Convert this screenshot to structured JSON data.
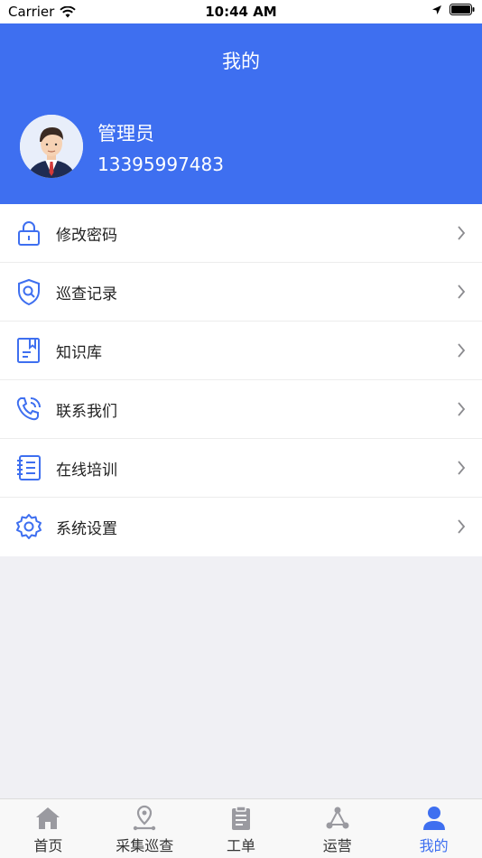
{
  "status_bar": {
    "carrier": "Carrier",
    "time": "10:44 AM"
  },
  "header": {
    "title": "我的"
  },
  "user": {
    "name": "管理员",
    "phone": "13395997483"
  },
  "menu": [
    {
      "label": "修改密码",
      "icon": "lock-icon"
    },
    {
      "label": "巡查记录",
      "icon": "shield-search-icon"
    },
    {
      "label": "知识库",
      "icon": "book-icon"
    },
    {
      "label": "联系我们",
      "icon": "phone-icon"
    },
    {
      "label": "在线培训",
      "icon": "notebook-icon"
    },
    {
      "label": "系统设置",
      "icon": "gear-icon"
    }
  ],
  "tabs": [
    {
      "label": "首页",
      "icon": "home-icon"
    },
    {
      "label": "采集巡查",
      "icon": "location-pin-icon"
    },
    {
      "label": "工单",
      "icon": "clipboard-icon"
    },
    {
      "label": "运营",
      "icon": "share-nodes-icon"
    },
    {
      "label": "我的",
      "icon": "user-icon",
      "active": true
    }
  ],
  "colors": {
    "accent": "#3e6ff0",
    "inactive_icon": "#9a9aa0"
  }
}
